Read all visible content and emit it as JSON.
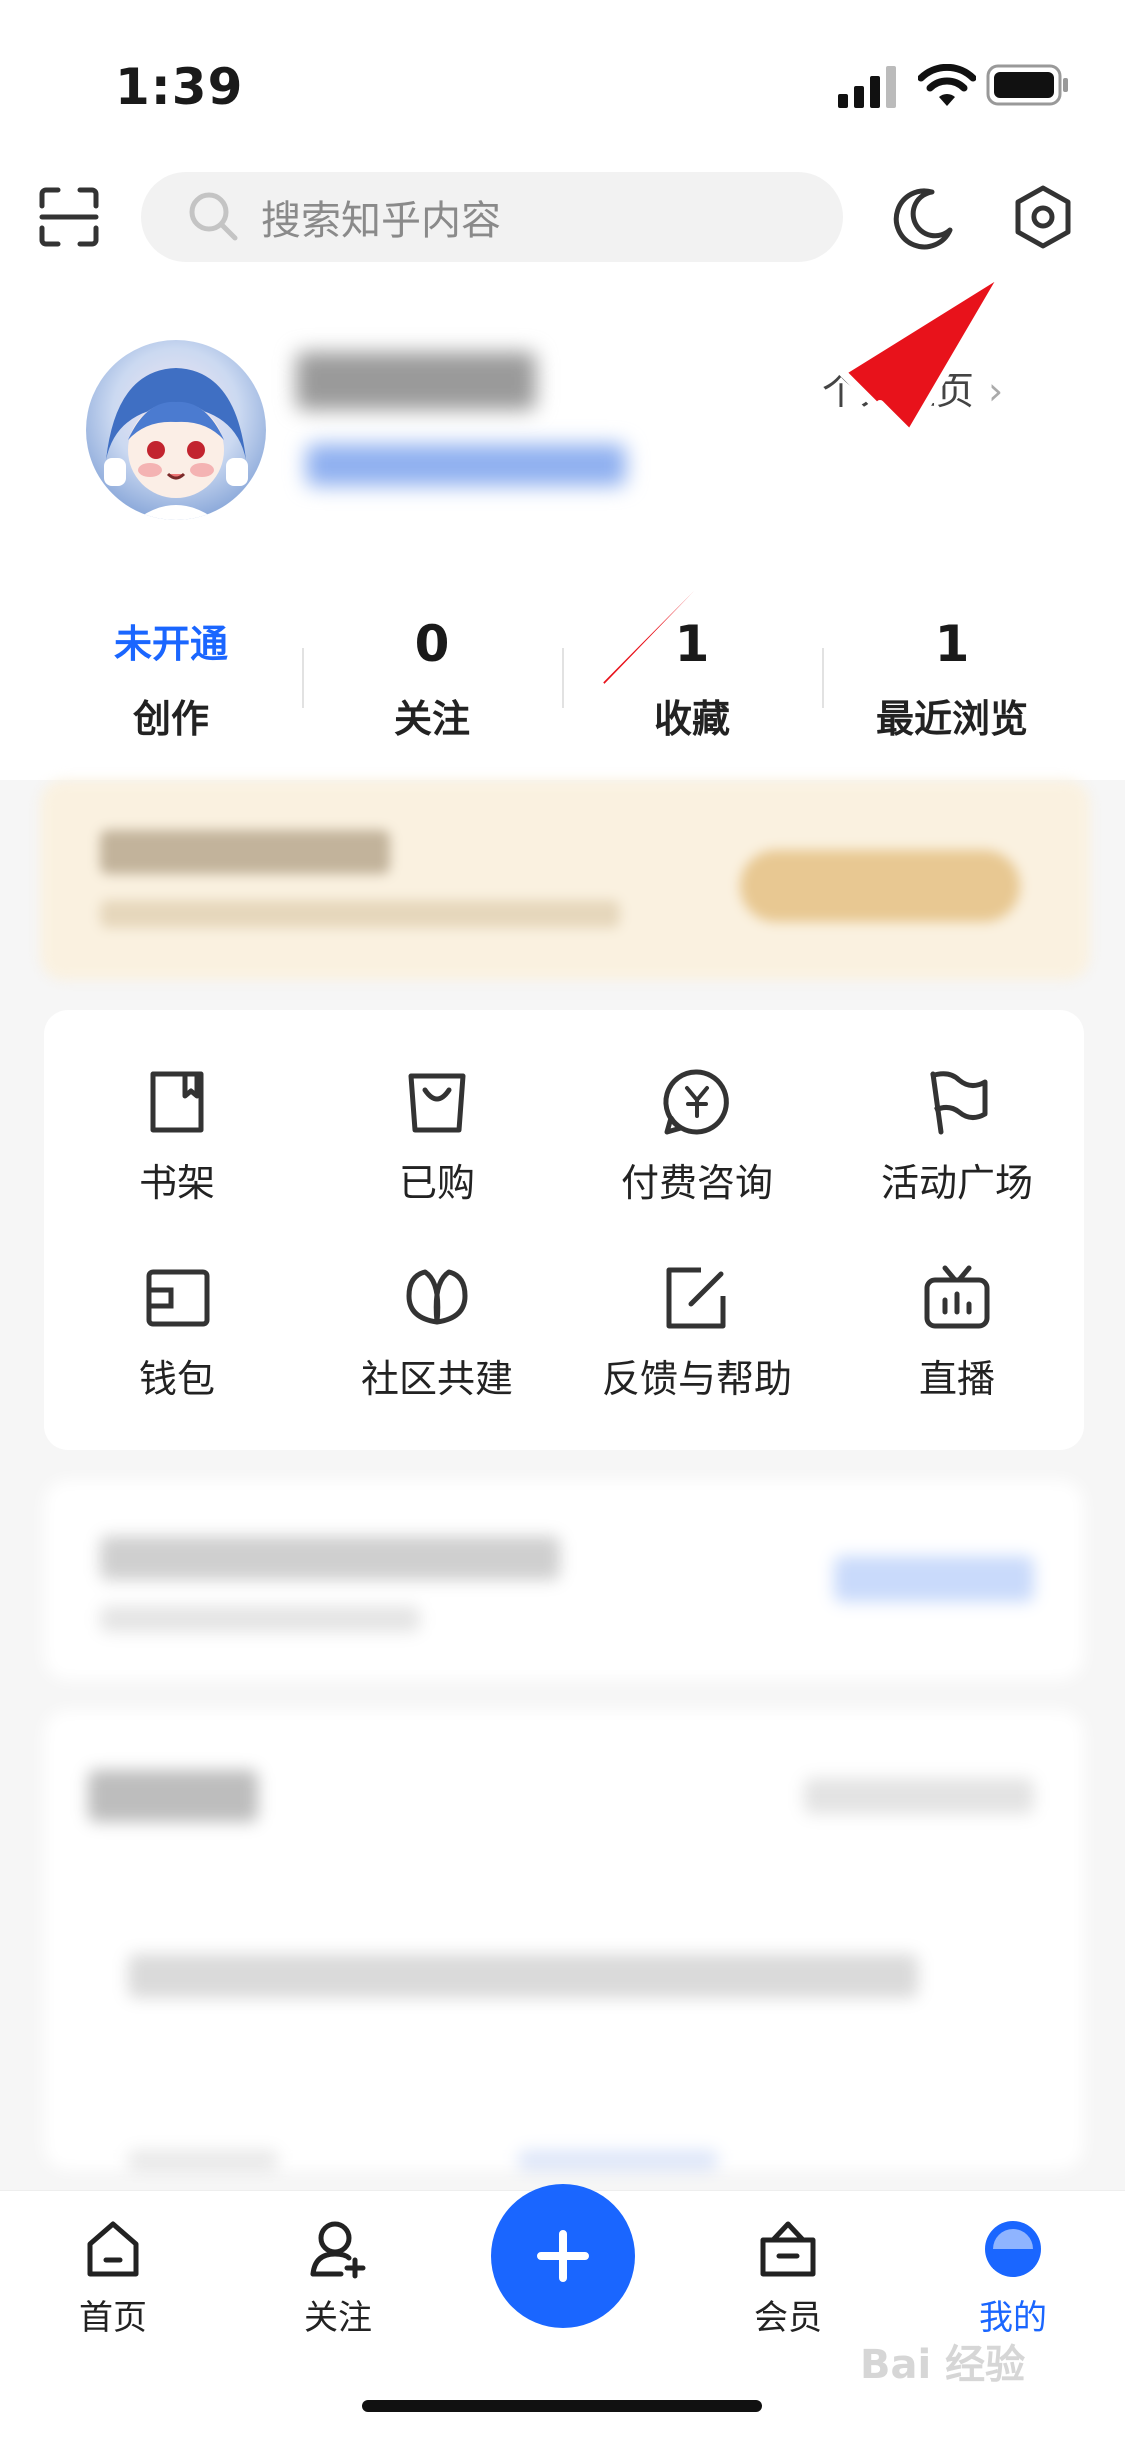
{
  "status_bar": {
    "time": "1:39"
  },
  "search": {
    "placeholder": "搜索知乎内容"
  },
  "profile": {
    "homepage_link": "个人主页"
  },
  "stats": [
    {
      "value": "未开通",
      "label": "创作"
    },
    {
      "value": "0",
      "label": "关注"
    },
    {
      "value": "1",
      "label": "收藏"
    },
    {
      "value": "1",
      "label": "最近浏览"
    }
  ],
  "grid": [
    {
      "label": "书架",
      "icon": "book-icon"
    },
    {
      "label": "已购",
      "icon": "bag-icon"
    },
    {
      "label": "付费咨询",
      "icon": "yen-chat-icon"
    },
    {
      "label": "活动广场",
      "icon": "flag-icon"
    },
    {
      "label": "钱包",
      "icon": "wallet-icon"
    },
    {
      "label": "社区共建",
      "icon": "leaf-icon"
    },
    {
      "label": "反馈与帮助",
      "icon": "edit-icon"
    },
    {
      "label": "直播",
      "icon": "tv-icon"
    }
  ],
  "nav": [
    {
      "label": "首页",
      "icon": "home-icon"
    },
    {
      "label": "关注",
      "icon": "follow-icon"
    },
    {
      "label": "会员",
      "icon": "vip-icon"
    },
    {
      "label": "我的",
      "icon": "me-icon"
    }
  ],
  "watermark": "Bai 经验",
  "colors": {
    "accent": "#1a66ff",
    "arrow": "#e8121b"
  }
}
